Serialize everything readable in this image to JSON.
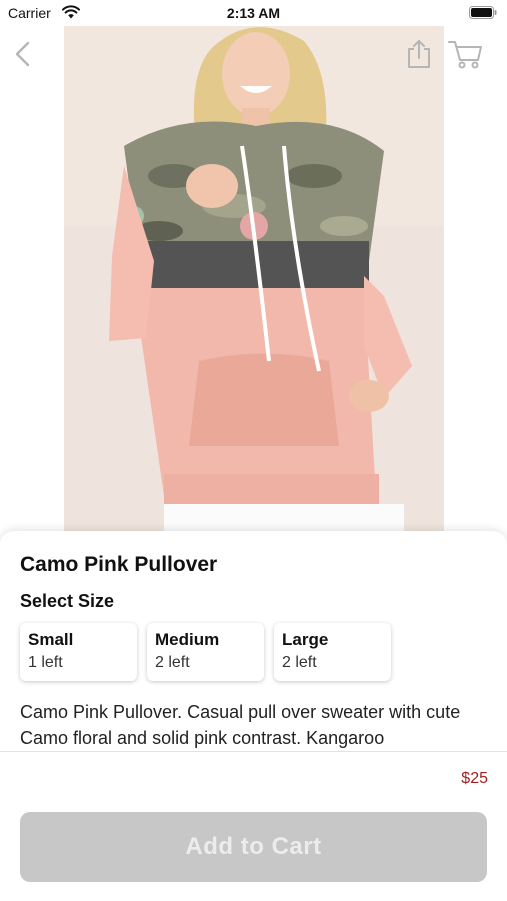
{
  "status_bar": {
    "carrier": "Carrier",
    "time": "2:13 AM"
  },
  "header": {
    "back_icon": "chevron-left-icon",
    "share_icon": "share-icon",
    "cart_icon": "shopping-cart-icon"
  },
  "product": {
    "title": "Camo Pink Pullover",
    "size_heading": "Select Size",
    "sizes": [
      {
        "name": "Small",
        "stock": "1 left"
      },
      {
        "name": "Medium",
        "stock": "2 left"
      },
      {
        "name": "Large",
        "stock": "2 left"
      }
    ],
    "description": "Camo Pink Pullover. Casual pull over sweater with cute Camo floral and solid pink contrast. Kangaroo",
    "price": "$25"
  },
  "footer": {
    "add_to_cart_label": "Add to Cart"
  },
  "colors": {
    "price": "#a3201e",
    "button_disabled": "#c7c7c7",
    "button_text": "#ececec",
    "icon_gray": "#b5b5b5"
  }
}
